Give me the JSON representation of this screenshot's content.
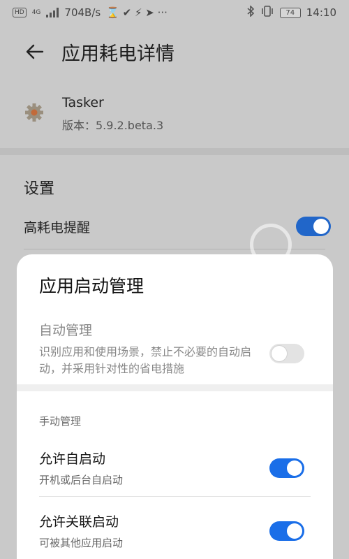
{
  "status_bar": {
    "badge_hd": "HD",
    "badge_4g": "4G",
    "net_speed": "704B/s",
    "extra_icons": "⌛ ✔ ⚡ ➤ ···",
    "battery": "74",
    "time": "14:10"
  },
  "header": {
    "title": "应用耗电详情",
    "back_icon": "arrow-left-icon"
  },
  "app": {
    "name": "Tasker",
    "version": "版本：5.9.2.beta.3",
    "icon": "gear-icon"
  },
  "settings": {
    "title": "设置",
    "high_usage_alert": {
      "label": "高耗电提醒",
      "enabled": true
    }
  },
  "sheet": {
    "title": "应用启动管理",
    "auto_manage": {
      "title": "自动管理",
      "description": "识别应用和使用场景，禁止不必要的自动启动，并采用针对性的省电措施",
      "enabled": false
    },
    "manual_title": "手动管理",
    "items": [
      {
        "title": "允许自启动",
        "subtitle": "开机或后台自启动",
        "enabled": true
      },
      {
        "title": "允许关联启动",
        "subtitle": "可被其他应用启动",
        "enabled": true
      }
    ]
  },
  "colors": {
    "accent": "#1a6ee8",
    "dim_background": "#c9c9c9",
    "sheet_background": "#ffffff"
  }
}
